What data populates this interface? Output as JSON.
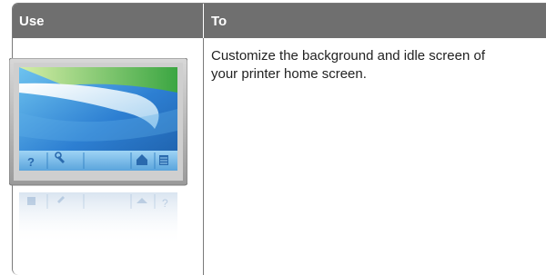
{
  "table": {
    "headers": [
      "Use",
      "To"
    ],
    "rows": [
      {
        "icon": "backgrounds-and-idle-screen-icon",
        "description": "Customize the background and idle screen of\nyour printer home screen."
      }
    ]
  },
  "colors": {
    "header_bg": "#6f6f6f",
    "header_text": "#ffffff",
    "border": "#7a7a7a"
  }
}
